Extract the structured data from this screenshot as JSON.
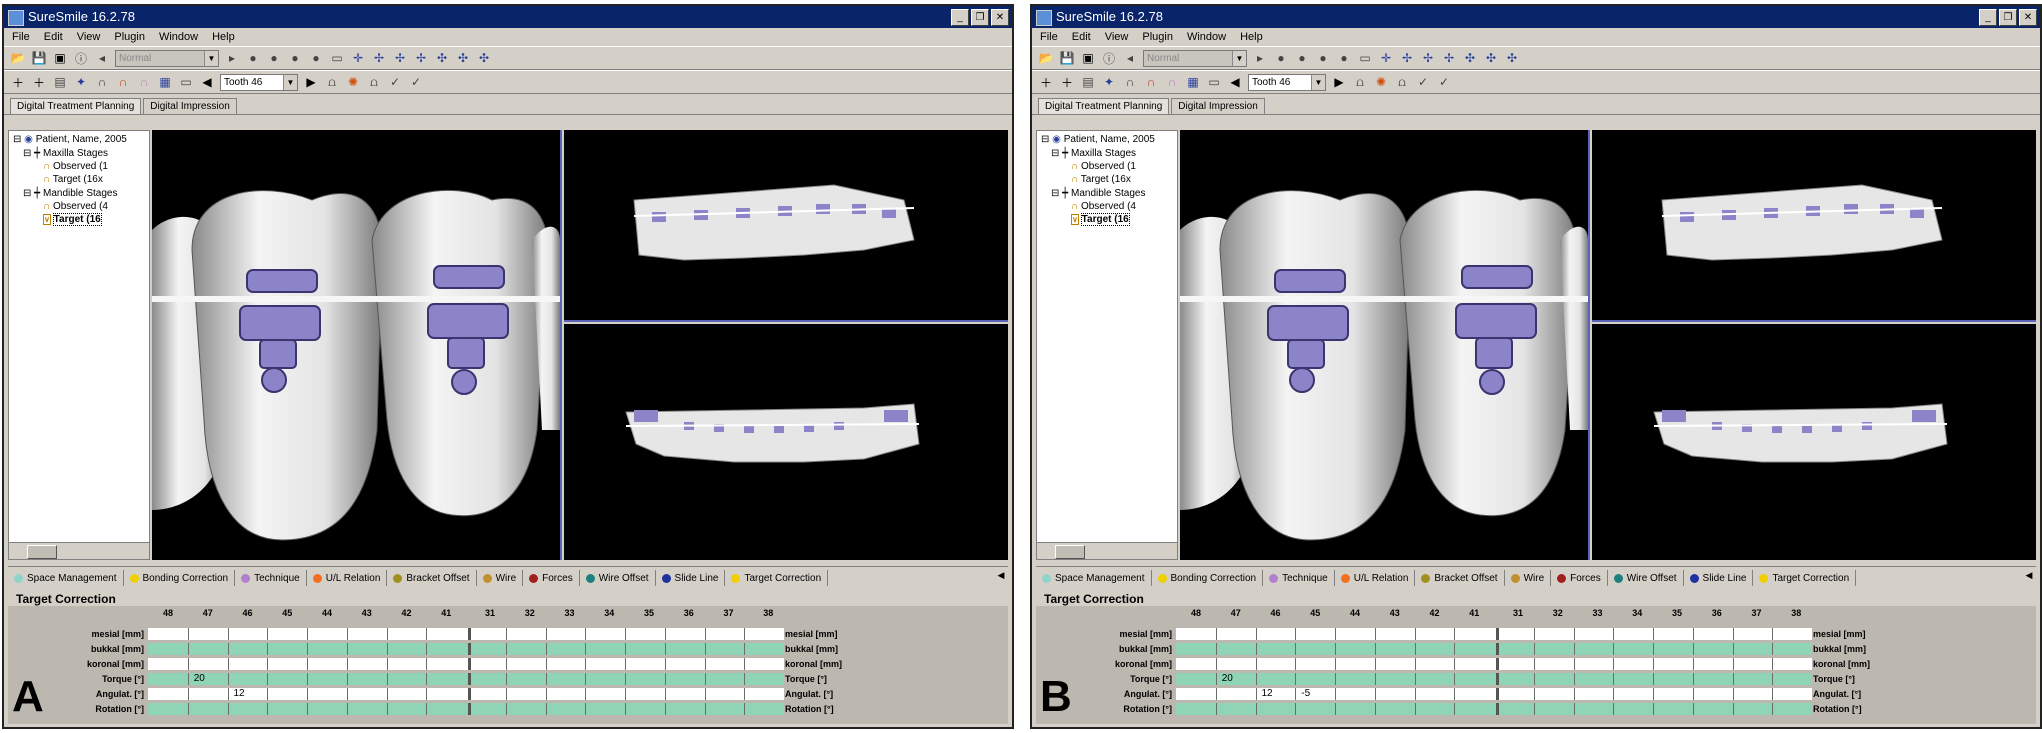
{
  "app": {
    "title": "SureSmile 16.2.78",
    "menu": [
      "File",
      "Edit",
      "View",
      "Plugin",
      "Window",
      "Help"
    ],
    "tooth_selector": "Tooth 46",
    "disabled_combo": "Normal"
  },
  "tabs": [
    "Digital Treatment Planning",
    "Digital Impression"
  ],
  "tree": {
    "patient": "Patient, Name, 2005",
    "maxilla": "Maxilla Stages",
    "maxilla_observed": "Observed (1",
    "maxilla_target": "Target (16x",
    "mandible": "Mandible Stages",
    "mandible_observed": "Observed (4",
    "mandible_target": "Target (16"
  },
  "plugins": [
    {
      "label": "Space Management",
      "color": "#8fd4c8"
    },
    {
      "label": "Bonding Correction",
      "color": "#f0d000"
    },
    {
      "label": "Technique",
      "color": "#b080d0"
    },
    {
      "label": "U/L Relation",
      "color": "#f07020"
    },
    {
      "label": "Bracket Offset",
      "color": "#a09020"
    },
    {
      "label": "Wire",
      "color": "#c09030"
    },
    {
      "label": "Forces",
      "color": "#a02020"
    },
    {
      "label": "Wire Offset",
      "color": "#208080"
    },
    {
      "label": "Slide Line",
      "color": "#2030a0"
    },
    {
      "label": "Target Correction",
      "color": "#f0d000"
    }
  ],
  "correction": {
    "title": "Target Correction",
    "teeth": [
      "48",
      "47",
      "46",
      "45",
      "44",
      "43",
      "42",
      "41",
      "31",
      "32",
      "33",
      "34",
      "35",
      "36",
      "37",
      "38"
    ],
    "rows": [
      {
        "label": "mesial [mm]",
        "rlabel": "mesial [mm]"
      },
      {
        "label": "bukkal [mm]",
        "rlabel": "bukkal [mm]"
      },
      {
        "label": "koronal [mm]",
        "rlabel": "koronal [mm]"
      },
      {
        "label": "Torque [°]",
        "rlabel": "Torque [°]"
      },
      {
        "label": "Angulat. [°]",
        "rlabel": "Angulat. [°]"
      },
      {
        "label": "Rotation [°]",
        "rlabel": "Rotation [°]"
      }
    ]
  },
  "panelA": {
    "letter": "A",
    "values": [
      {
        "row": 3,
        "col": 1,
        "text": "20"
      },
      {
        "row": 4,
        "col": 2,
        "text": "12"
      }
    ]
  },
  "panelB": {
    "letter": "B",
    "values": [
      {
        "row": 3,
        "col": 1,
        "text": "20"
      },
      {
        "row": 4,
        "col": 2,
        "text": "12"
      },
      {
        "row": 4,
        "col": 3,
        "text": "-5"
      }
    ]
  }
}
